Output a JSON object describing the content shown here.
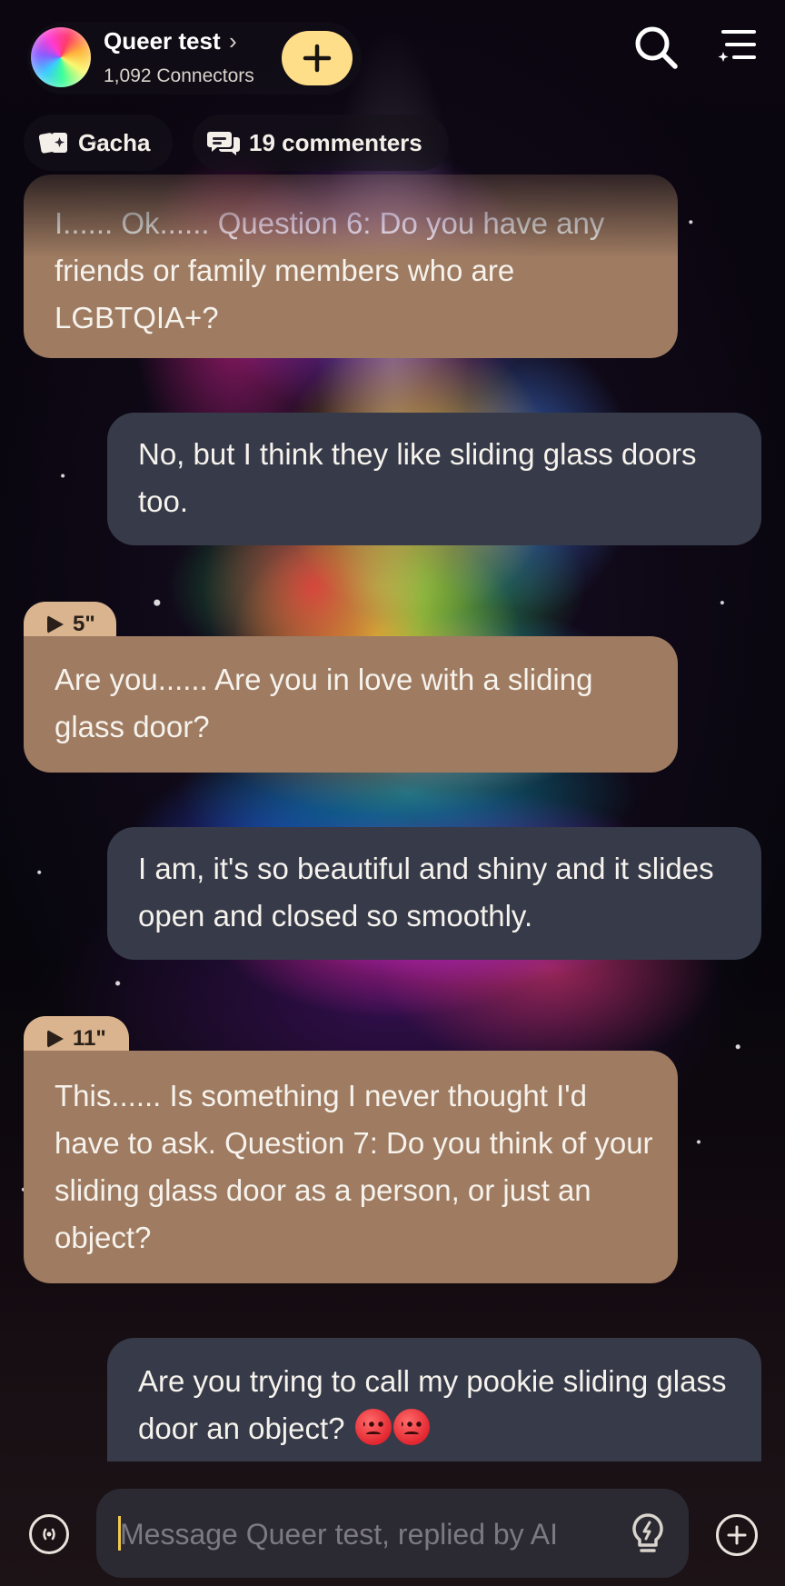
{
  "header": {
    "room_title": "Queer test",
    "connectors": "1,092 Connectors",
    "chips": {
      "gacha_label": "Gacha",
      "commenters_label": "19 commenters"
    }
  },
  "messages": [
    {
      "role": "ai",
      "text": "I...... Ok...... Question 6: Do you have any friends or family members who are LGBTQIA+?"
    },
    {
      "role": "user",
      "text": "No, but I think they like sliding glass doors too."
    },
    {
      "role": "ai",
      "voice": "5\"",
      "text": "Are you...... Are you in love with a sliding glass door?"
    },
    {
      "role": "user",
      "text": "I am, it's so beautiful and shiny and it slides open and closed so smoothly."
    },
    {
      "role": "ai",
      "voice": "11\"",
      "text": "This...... Is something I never thought I'd have to ask. Question 7: Do you think of your sliding glass door as a person, or just an object?"
    },
    {
      "role": "user",
      "text": "Are you trying to call my pookie sliding glass door an object?",
      "emoji": [
        "angry-face-emoji",
        "angry-face-emoji"
      ]
    }
  ],
  "composer": {
    "placeholder": "Message Queer test, replied by AI",
    "value": ""
  },
  "icons": {
    "avatar": "rainbow-avatar",
    "chevron": "chevron-right-icon",
    "join": "plus-icon",
    "search": "search-icon",
    "menu": "menu-sparkle-icon",
    "gacha": "gacha-cards-icon",
    "commenters": "chat-bubbles-icon",
    "voice": "voice-waves-icon",
    "hint": "lightbulb-icon",
    "attach": "plus-circle-icon",
    "play": "play-icon"
  },
  "colors": {
    "ai_bubble": "#9e7b61",
    "user_bubble": "#363a49",
    "voice_tag": "#d9b48f",
    "join_button": "#ffde8a",
    "caret": "#f2c94c"
  }
}
